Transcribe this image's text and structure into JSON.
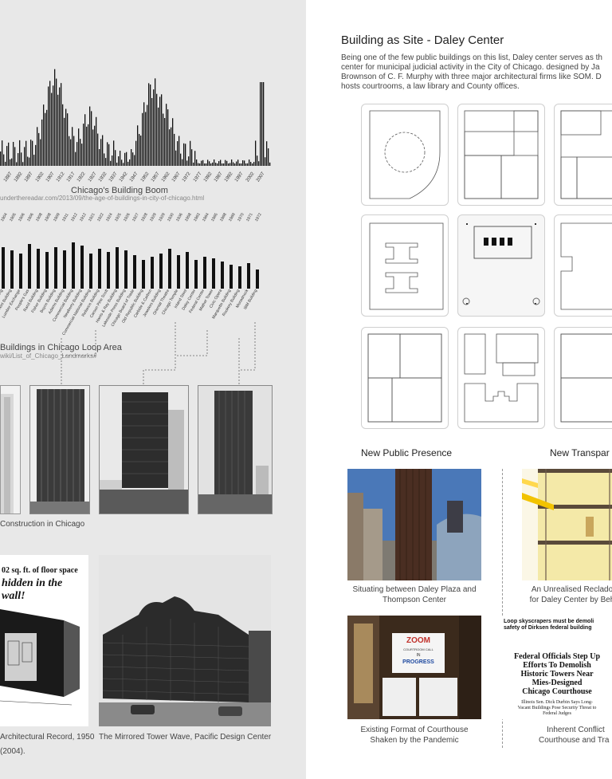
{
  "left": {
    "boom_chart": {
      "title": "Chicago's Building Boom",
      "url": "underthereadar.com/2013/09/the-age-of-buildings-in-city-of-chicago.html",
      "year_labels": [
        "1887",
        "1892",
        "1897",
        "1902",
        "1907",
        "1912",
        "1917",
        "1922",
        "1927",
        "1932",
        "1937",
        "1942",
        "1947",
        "1952",
        "1957",
        "1962",
        "1967",
        "1972",
        "1977",
        "1982",
        "1987",
        "1992",
        "1997",
        "2002",
        "2007"
      ]
    },
    "loop_chart": {
      "title": "Buildings in Chicago Loop Area",
      "url": "wiki/List_of_Chicago_Landmarks#",
      "year_labels": [
        "1904",
        "1905",
        "1906",
        "1906",
        "1908",
        "1908",
        "1909",
        "1911",
        "1912",
        "1912",
        "1921",
        "1922",
        "1924",
        "1925",
        "1926",
        "1927",
        "1928",
        "1929",
        "1929",
        "1930",
        "1936",
        "1958",
        "1963",
        "1964",
        "1965",
        "1968",
        "1969",
        "1970",
        "1971",
        "1972"
      ],
      "building_labels": [
        "Crocker Building",
        "Kent Building",
        "Lumber Exchange",
        "People's Gas",
        "Rand Building",
        "Fisher Building",
        "Boyce Building",
        "Adams Building",
        "Commercial Building",
        "Newberry Building",
        "Commercial National Building",
        "Reliance Building",
        "Carson Pirie Scott",
        "Harris & Ray Building",
        "Lakeside Press Building",
        "Chicago Board of Trade",
        "Old Republic Building",
        "Carbide & Carbon",
        "Jewelers Building",
        "Oriental Theatre",
        "Chicago Temple",
        "Inland Steel",
        "Daley Center",
        "Federal Center",
        "Mather Tower",
        "Civic Opera",
        "Marquette Building",
        "Rookery Building",
        "Monadnock",
        "IBM Building"
      ]
    },
    "towers_caption": "Construction in Chicago",
    "ad": {
      "line1": "02 sq. ft. of floor space",
      "line2": "hidden in the wall!",
      "caption": "Architectural Record, 1950",
      "caption2": "(2004)."
    },
    "pdc_caption": "The Mirrored Tower Wave, Pacific Design Center"
  },
  "right": {
    "title": "Building as Site - Daley Center",
    "intro": [
      "Being one of the few public buildings on this list, Daley center serves as th",
      "center for municipal judicial activity in the City of Chicago. designed by Ja",
      "Brownson of C. F. Murphy with three major architectural firms like SOM. D",
      "hosts courtrooms, a law library and County offices."
    ],
    "col1_heading": "New Public Presence",
    "col2_heading": "New Transpar",
    "captions": {
      "plaza": [
        "Situating between Daley Plaza and",
        "Thompson Center"
      ],
      "reclad": [
        "An Unrealised Reclado",
        "for Daley Center by Beh"
      ],
      "zoom": [
        "Existing Format of Courthouse",
        "Shaken by the Pandemic"
      ],
      "conflict": [
        "Inherent Conflict",
        "Courthouse and Tra"
      ]
    },
    "zoom_sign": {
      "title": "ZOOM",
      "sub": "COURTROOM CALL",
      "in": "IN",
      "progress": "PROGRESS"
    },
    "news": {
      "headline_top": [
        "Loop skyscrapers must be demoli",
        "safety of Dirksen federal building"
      ],
      "headline_main": [
        "Federal Officials Step Up",
        "Efforts To Demolish",
        "Historic Towers Near",
        "Mies-Designed",
        "Chicago Courthouse"
      ],
      "deck": [
        "Illinois Sen. Dick Durbin Says Long-",
        "Vacant Buildings Pose Security Threat to",
        "Federal Judges"
      ]
    }
  },
  "colors": {
    "left_bg": "#e8e8e8",
    "bar": "#111111",
    "text": "#333333"
  }
}
